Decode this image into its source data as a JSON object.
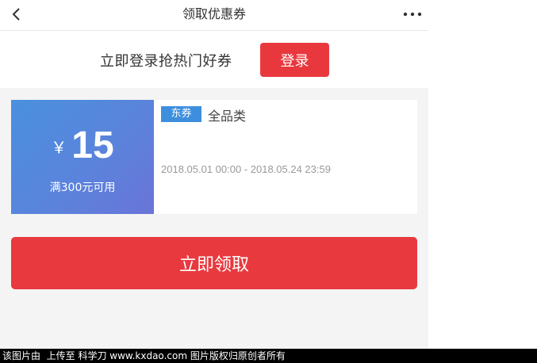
{
  "header": {
    "title": "领取优惠券",
    "back_icon": "chevron-left-icon",
    "more_icon": "more-dots-icon"
  },
  "login": {
    "prompt": "立即登录抢热门好券",
    "button_label": "登录"
  },
  "coupon": {
    "currency": "￥",
    "amount": "15",
    "condition": "满300元可用",
    "tag": "东券",
    "category": "全品类",
    "validity": "2018.05.01 00:00 - 2018.05.24 23:59"
  },
  "claim": {
    "button_label": "立即领取"
  },
  "watermark": {
    "text": "该图片由  上传至 科学刀 www.kxdao.com 图片版权归原创者所有"
  },
  "colors": {
    "primary_red": "#e8383e",
    "coupon_blue_start": "#4a90de",
    "coupon_blue_end": "#6a74d8",
    "tag_blue": "#3d8fde",
    "page_bg": "#f4f4f4"
  }
}
